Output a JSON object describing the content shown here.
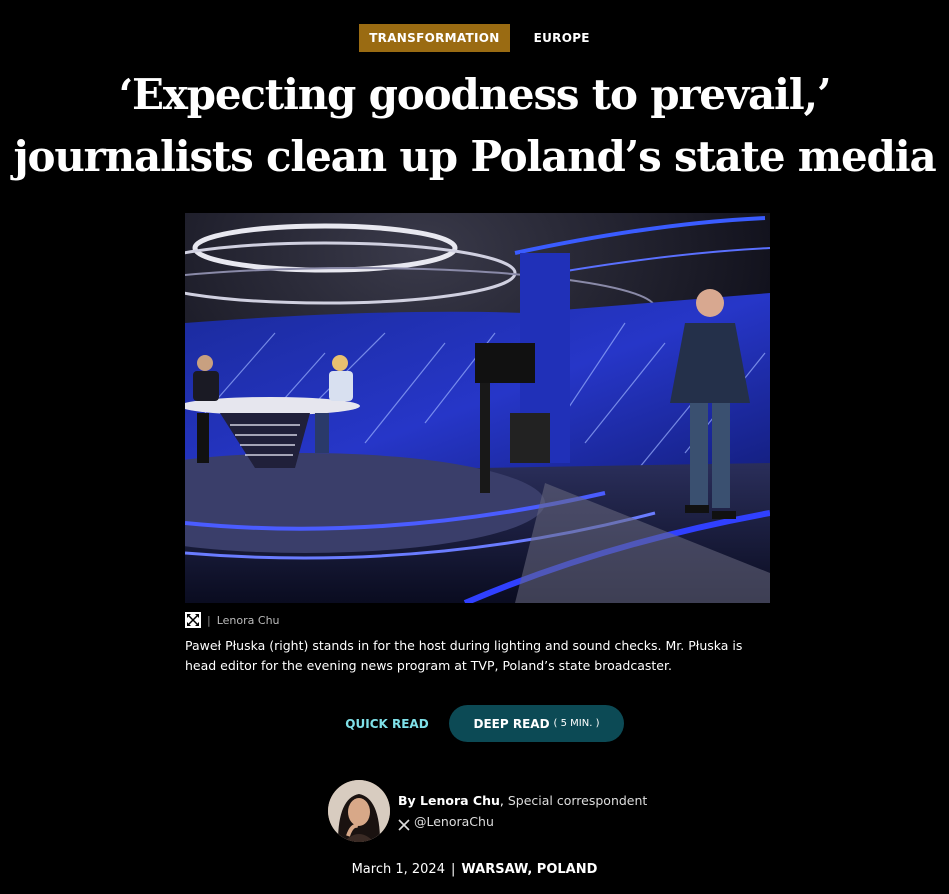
{
  "tags": {
    "primary": "TRANSFORMATION",
    "secondary": "EUROPE"
  },
  "headline": {
    "line1": "‘Expecting goodness to prevail,’",
    "line2": "journalists clean up Poland’s state media"
  },
  "photo": {
    "credit": "Lenora Chu",
    "caption": "Paweł Płuska (right) stands in for the host during lighting and sound checks. Mr. Płuska is head editor for the evening news program at TVP, Poland’s state broadcaster.",
    "expand_icon": "expand-icon"
  },
  "read_toggle": {
    "quick_label": "QUICK READ",
    "deep_label": "DEEP READ",
    "deep_duration": "( 5 MIN. )"
  },
  "byline": {
    "author": "By Lenora Chu",
    "role": "Special correspondent",
    "handle": "@LenoraChu",
    "social_icon": "x-icon"
  },
  "dateline": {
    "date": "March 1, 2024",
    "place": "WARSAW, POLAND"
  },
  "colors": {
    "tag_bg": "#9a6b12",
    "quick_read": "#7fe0e8",
    "deep_read_bg": "#0c4a55"
  }
}
